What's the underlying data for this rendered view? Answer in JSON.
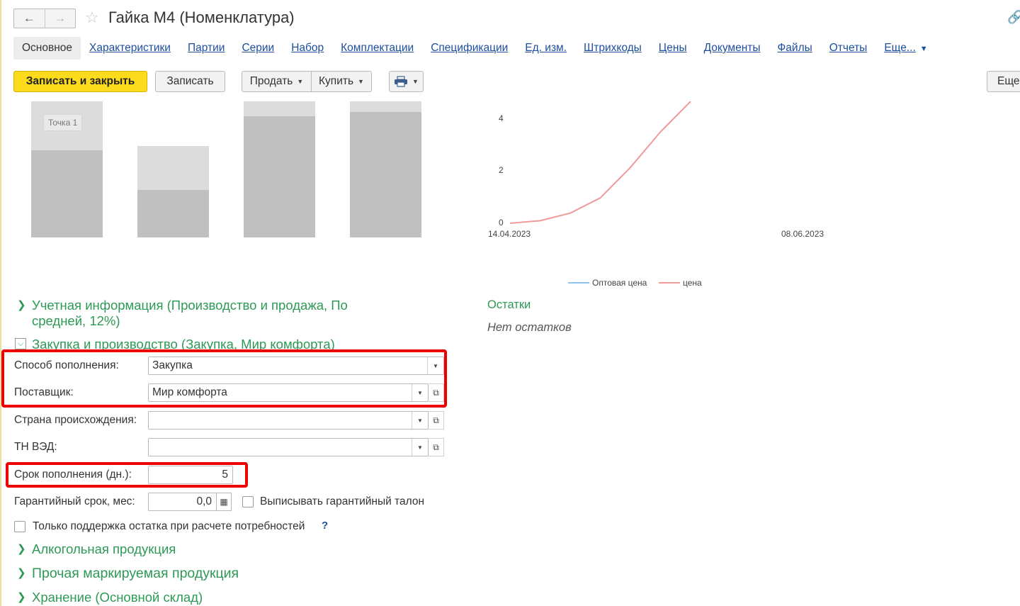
{
  "window": {
    "title": "Гайка М4 (Номенклатура)"
  },
  "tabs": [
    {
      "label": "Основное",
      "active": true
    },
    {
      "label": "Характеристики"
    },
    {
      "label": "Партии"
    },
    {
      "label": "Серии"
    },
    {
      "label": "Набор"
    },
    {
      "label": "Комплектации"
    },
    {
      "label": "Спецификации"
    },
    {
      "label": "Ед. изм."
    },
    {
      "label": "Штрихкоды"
    },
    {
      "label": "Цены"
    },
    {
      "label": "Документы"
    },
    {
      "label": "Файлы"
    },
    {
      "label": "Отчеты"
    },
    {
      "label": "Еще..."
    }
  ],
  "toolbar": {
    "save_close": "Записать и закрыть",
    "save": "Записать",
    "sell": "Продать",
    "buy": "Купить",
    "more": "Еще"
  },
  "bar_chart": {
    "tooltip": "Точка 1",
    "bars": [
      {
        "value": 0.64,
        "max": 1.0
      },
      {
        "value": 0.52,
        "max": 1.0
      },
      {
        "value": 0.89,
        "max": 1.0
      },
      {
        "value": 0.92,
        "max": 1.0
      }
    ]
  },
  "chart_data": {
    "type": "line",
    "x": [
      "14.04.2023",
      "08.06.2023"
    ],
    "y_ticks": [
      "0",
      "2",
      "4"
    ],
    "series": [
      {
        "name": "Оптовая цена",
        "color": "#8fc3ea",
        "values": []
      },
      {
        "name": "цена",
        "color": "#f09a9a",
        "values": [
          0,
          0.1,
          0.4,
          1.0,
          2.2,
          3.6,
          4.8
        ]
      }
    ],
    "ylim": [
      0,
      4.8
    ]
  },
  "stock": {
    "title": "Остатки",
    "empty": "Нет остатков"
  },
  "sections": {
    "accounting": "Учетная информация (Производство и продажа, По средней, 12%)",
    "purchase": "Закупка и производство (Закупка, Мир комфорта)",
    "alcohol": "Алкогольная продукция",
    "marked": "Прочая маркируемая продукция",
    "storage": "Хранение (Основной склад)"
  },
  "fields": {
    "replenish_method": {
      "label": "Способ пополнения:",
      "value": "Закупка"
    },
    "supplier": {
      "label": "Поставщик:",
      "value": "Мир комфорта"
    },
    "country": {
      "label": "Страна происхождения:",
      "value": ""
    },
    "tnved": {
      "label": "ТН ВЭД:",
      "value": ""
    },
    "lead_time": {
      "label": "Срок пополнения (дн.):",
      "value": "5"
    },
    "warranty": {
      "label": "Гарантийный срок, мес:",
      "value": "0,0"
    },
    "warranty_ticket": {
      "label": "Выписывать гарантийный талон"
    },
    "only_support": {
      "label": "Только поддержка остатка при расчете потребностей",
      "hint": "?"
    }
  }
}
